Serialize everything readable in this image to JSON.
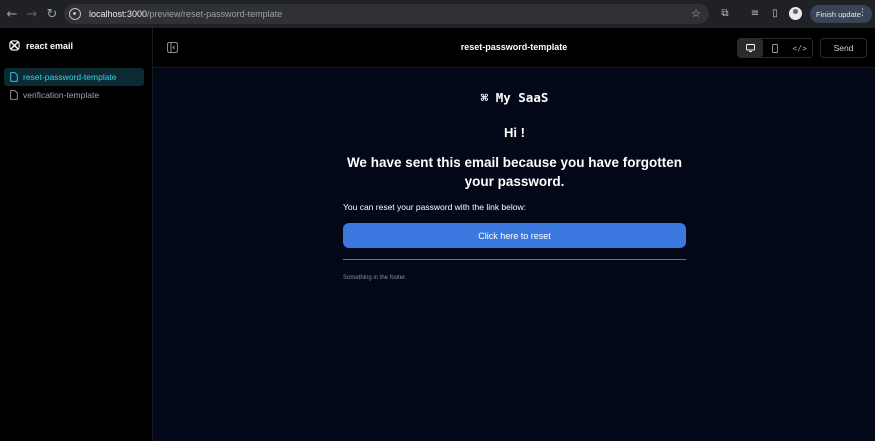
{
  "browser": {
    "url_host": "localhost:3000",
    "url_path": "/preview/reset-password-template",
    "finish_update_label": "Finish update"
  },
  "sidebar": {
    "brand": "react email",
    "items": [
      {
        "label": "reset-password-template",
        "active": true
      },
      {
        "label": "verification-template",
        "active": false
      }
    ]
  },
  "topbar": {
    "title": "reset-password-template",
    "send_label": "Send",
    "view_modes": [
      "desktop-icon",
      "mobile-icon",
      "code-icon"
    ]
  },
  "email": {
    "brand_symbol": "⌘",
    "brand_name": "My SaaS",
    "greeting": "Hi !",
    "headline": "We have sent this email because you have forgotten your password.",
    "body": "You can reset your password with the link below:",
    "cta_label": "Click here to reset",
    "footer": "Something in the footer."
  },
  "colors": {
    "preview_bg": "#020817",
    "cta_bg": "#3a78e0",
    "active_nav_text": "#35d4e8"
  }
}
